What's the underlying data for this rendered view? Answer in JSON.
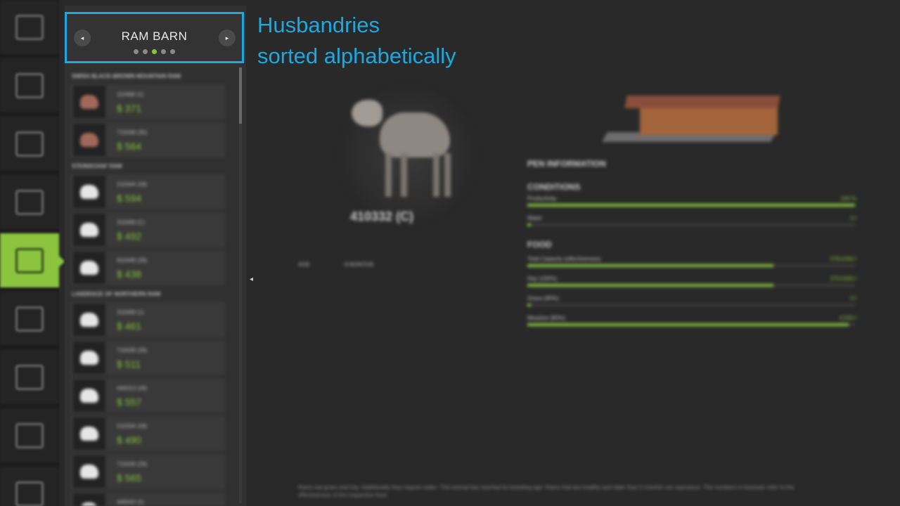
{
  "rail": {
    "items": [
      {
        "icon": "bank-icon"
      },
      {
        "icon": "map-icon"
      },
      {
        "icon": "calendar-icon"
      },
      {
        "icon": "production-icon"
      },
      {
        "icon": "animals-icon",
        "active": true
      },
      {
        "icon": "contracts-icon"
      },
      {
        "icon": "price-icon"
      },
      {
        "icon": "finances-icon"
      },
      {
        "icon": "statistics-icon"
      }
    ]
  },
  "header": {
    "title": "RAM BARN",
    "prev_glyph": "◂",
    "next_glyph": "▸",
    "page_count": 5,
    "active_page": 3
  },
  "annotation": {
    "line1": "Husbandries",
    "line2": "sorted alphabetically"
  },
  "list": {
    "groups": [
      {
        "title": "SWISS BLACK-BROWN MOUNTAIN RAM",
        "rows": [
          {
            "name": "110489 (1)",
            "price": "$ 371",
            "color": "brown"
          },
          {
            "name": "710048 (30)",
            "price": "$ 564",
            "color": "brown"
          }
        ]
      },
      {
        "title": "STEINSCHAF RAM",
        "rows": [
          {
            "name": "210344 (29)",
            "price": "$ 594",
            "color": "white"
          },
          {
            "name": "310089 (C)",
            "price": "$ 492",
            "color": "white"
          },
          {
            "name": "910448 (29)",
            "price": "$ 438",
            "color": "white"
          }
        ]
      },
      {
        "title": "LANDRACE OF NORTHERN RAM",
        "rows": [
          {
            "name": "310089 (1)",
            "price": "$ 461",
            "color": "white"
          },
          {
            "name": "710038 (29)",
            "price": "$ 511",
            "color": "white"
          },
          {
            "name": "440013 (29)",
            "price": "$ 557",
            "color": "white"
          },
          {
            "name": "510334 (29)",
            "price": "$ 490",
            "color": "white"
          },
          {
            "name": "710039 (29)",
            "price": "$ 565",
            "color": "white"
          },
          {
            "name": "440042 (1)",
            "price": "",
            "color": "white"
          }
        ]
      }
    ]
  },
  "animal": {
    "id": "410332 (C)",
    "age_label": "AGE",
    "age_value": "8 MONTHS"
  },
  "pen": {
    "title": "PEN INFORMATION",
    "conditions_title": "CONDITIONS",
    "conditions": [
      {
        "label": "Productivity",
        "value": "100 %",
        "fill": 1.0
      },
      {
        "label": "Water",
        "value": "0 l",
        "fill": 0.01
      }
    ],
    "food_title": "FOOD",
    "food": [
      {
        "label": "Total Capacity (effectiveness)",
        "value": "375/1000 l",
        "fill": 0.75
      },
      {
        "label": "Hay (100%)",
        "value": "375/1000 l",
        "fill": 0.75
      },
      {
        "label": "Grass (80%)",
        "value": "0 l",
        "fill": 0.01
      },
      {
        "label": "Meadow (80%)",
        "value": "4,500 l",
        "fill": 0.98
      }
    ]
  },
  "footnote": "Rams eat grass and hay. Additionally they require water. This animal has reached its breeding age. Rams that are healthy and older than 5 months can reproduce. The numbers in brackets refer to the effectiveness of the respective food.",
  "colors": {
    "accent": "#8bc53f",
    "annotation": "#1ea8e0",
    "background": "#292929"
  }
}
